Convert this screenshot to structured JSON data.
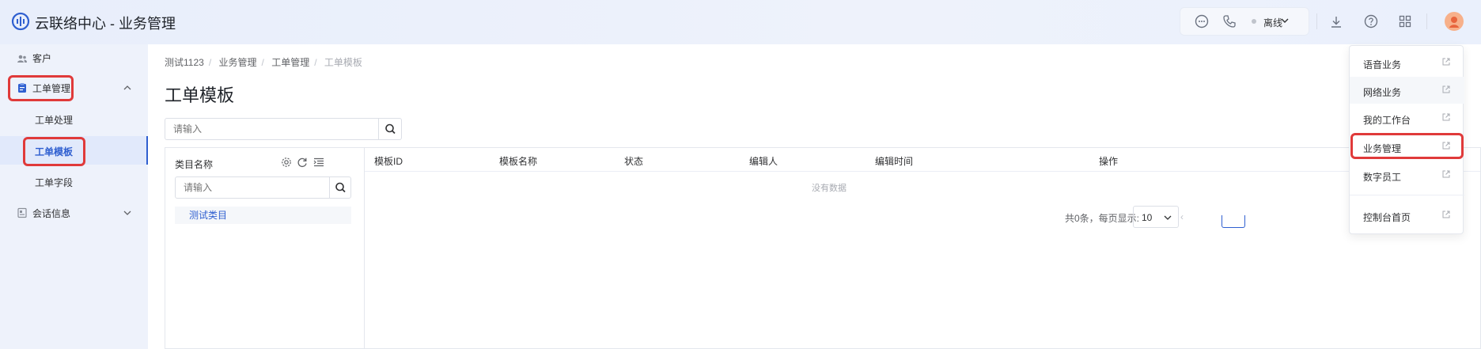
{
  "header": {
    "app_title": "云联络中心 - 业务管理",
    "status_label": "离线",
    "icons": [
      "chat-icon",
      "phone-icon",
      "chevron-down-icon",
      "download-icon",
      "help-icon",
      "apps-grid-icon",
      "avatar"
    ]
  },
  "sidebar": {
    "items": [
      {
        "label": "客户",
        "icon": "users-icon"
      },
      {
        "label": "工单管理",
        "icon": "clipboard-icon",
        "expanded": true
      },
      {
        "label": "工单处理"
      },
      {
        "label": "工单模板",
        "active": true
      },
      {
        "label": "工单字段"
      },
      {
        "label": "会话信息",
        "icon": "chat-record-icon",
        "expanded": false
      }
    ]
  },
  "breadcrumb": [
    "测试1123",
    "业务管理",
    "工单管理",
    "工单模板"
  ],
  "page_title": "工单模板",
  "search": {
    "placeholder": "请输入"
  },
  "category_panel": {
    "title": "类目名称",
    "search_placeholder": "请输入",
    "tools": [
      "settings-icon",
      "refresh-icon",
      "list-indent-icon"
    ],
    "nodes": [
      "测试类目"
    ]
  },
  "table": {
    "columns": [
      "模板ID",
      "模板名称",
      "状态",
      "编辑人",
      "编辑时间",
      "操作"
    ],
    "empty_text": "没有数据"
  },
  "pagination": {
    "total_text": "共0条，每页显示:",
    "page_size": "10"
  },
  "dropdown": {
    "items": [
      "语音业务",
      "网络业务",
      "我的工作台",
      "业务管理",
      "数字员工",
      "控制台首页"
    ]
  },
  "colors": {
    "accent": "#2f5fd0",
    "highlight": "#e03a3a",
    "background": "#eef2fb"
  }
}
